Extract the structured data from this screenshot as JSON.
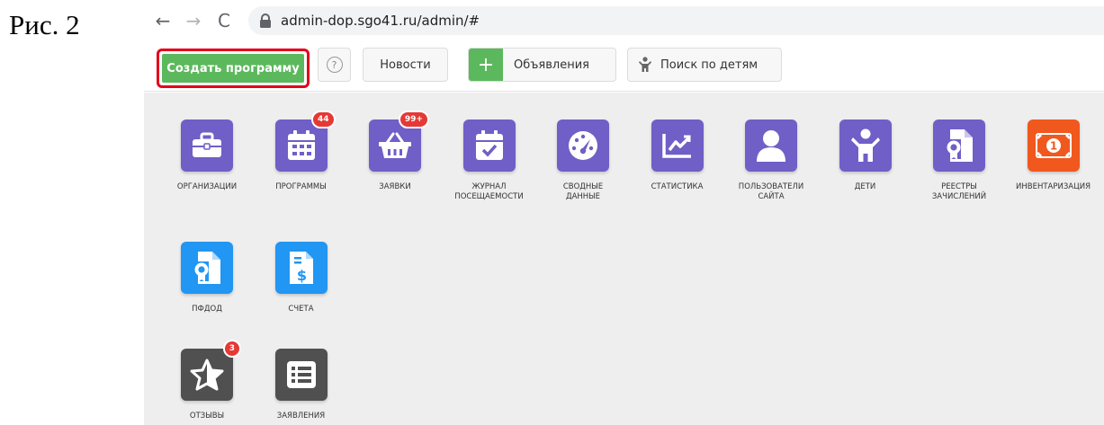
{
  "caption": "Рис. 2",
  "browser": {
    "back_glyph": "←",
    "forward_glyph": "→",
    "reload_glyph": "C",
    "url": "admin-dop.sgo41.ru/admin/#"
  },
  "toolbar": {
    "create_label": "Создать программу",
    "help_glyph": "?",
    "news_label": "Новости",
    "ads_plus": "+",
    "ads_label": "Объявления",
    "kids_label": "Поиск по детям"
  },
  "colors": {
    "purple": "#6f5fc6",
    "orange": "#f0581e",
    "blue": "#2196f3",
    "gray": "#505050",
    "green": "#5cb85c",
    "highlight": "#e3001b"
  },
  "tiles": [
    {
      "label": "Организации",
      "icon": "briefcase-icon",
      "color": "purple"
    },
    {
      "label": "Программы",
      "icon": "calendar-grid-icon",
      "color": "purple",
      "badge": "44"
    },
    {
      "label": "Заявки",
      "icon": "basket-icon",
      "color": "purple",
      "badge": "99+"
    },
    {
      "label": "Журнал\nпосещаемости",
      "icon": "calendar-check-icon",
      "color": "purple"
    },
    {
      "label": "Сводные\nданные",
      "icon": "gauge-icon",
      "color": "purple"
    },
    {
      "label": "Статистика",
      "icon": "line-chart-icon",
      "color": "purple"
    },
    {
      "label": "Пользователи\nсайта",
      "icon": "user-icon",
      "color": "purple"
    },
    {
      "label": "Дети",
      "icon": "child-icon",
      "color": "purple"
    },
    {
      "label": "Реестры\nзачислений",
      "icon": "certificate-icon",
      "color": "purple"
    },
    {
      "label": "Инвентаризация",
      "icon": "banknote-icon",
      "color": "orange"
    },
    {
      "label": "ПФДОД",
      "icon": "certificate-icon",
      "color": "blue"
    },
    {
      "label": "Счета",
      "icon": "invoice-icon",
      "color": "blue"
    },
    {
      "label": "Отзывы",
      "icon": "star-icon",
      "color": "gray",
      "badge": "3"
    },
    {
      "label": "Заявления",
      "icon": "list-icon",
      "color": "gray"
    }
  ]
}
